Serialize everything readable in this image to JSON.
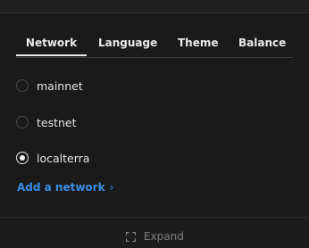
{
  "tabs": {
    "network": "Network",
    "language": "Language",
    "theme": "Theme",
    "balance": "Balance",
    "active": "network"
  },
  "networks": [
    {
      "label": "mainnet",
      "selected": false
    },
    {
      "label": "testnet",
      "selected": false
    },
    {
      "label": "localterra",
      "selected": true
    }
  ],
  "add_network": {
    "label": "Add a network",
    "chevron": "›",
    "icon": "chevron-right-icon"
  },
  "footer": {
    "expand_label": "Expand",
    "expand_icon": "expand-icon"
  },
  "colors": {
    "background": "#1a1a1a",
    "text": "#e6e6e6",
    "link": "#3b8ee6",
    "muted": "#7d7d7d"
  }
}
